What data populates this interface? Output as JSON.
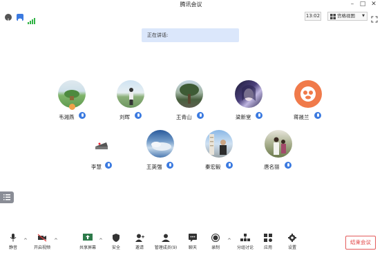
{
  "window": {
    "title": "腾讯会议"
  },
  "topbar": {
    "time": "13:02",
    "view_label": "宫格视图"
  },
  "speaking": {
    "label": "正在讲话:"
  },
  "participants": [
    {
      "name": "韦湘燕"
    },
    {
      "name": "刘晖"
    },
    {
      "name": "王青山"
    },
    {
      "name": "梁新堂"
    },
    {
      "name": "蒋晟兰"
    },
    {
      "name": "李慧"
    },
    {
      "name": "王英强"
    },
    {
      "name": "秦宏毅"
    },
    {
      "name": "唐名丽"
    }
  ],
  "toolbar": {
    "mute": "静音",
    "video": "开启视频",
    "share": "共享屏幕",
    "security": "安全",
    "invite": "邀请",
    "members": "管理成员(9)",
    "chat": "聊天",
    "record": "录制",
    "breakout": "分组讨论",
    "apps": "应用",
    "settings": "设置",
    "end": "结束会议"
  },
  "colors": {
    "accent": "#3b7ae0",
    "danger": "#e03c3c",
    "speaking_bg": "#dbe7fb"
  }
}
